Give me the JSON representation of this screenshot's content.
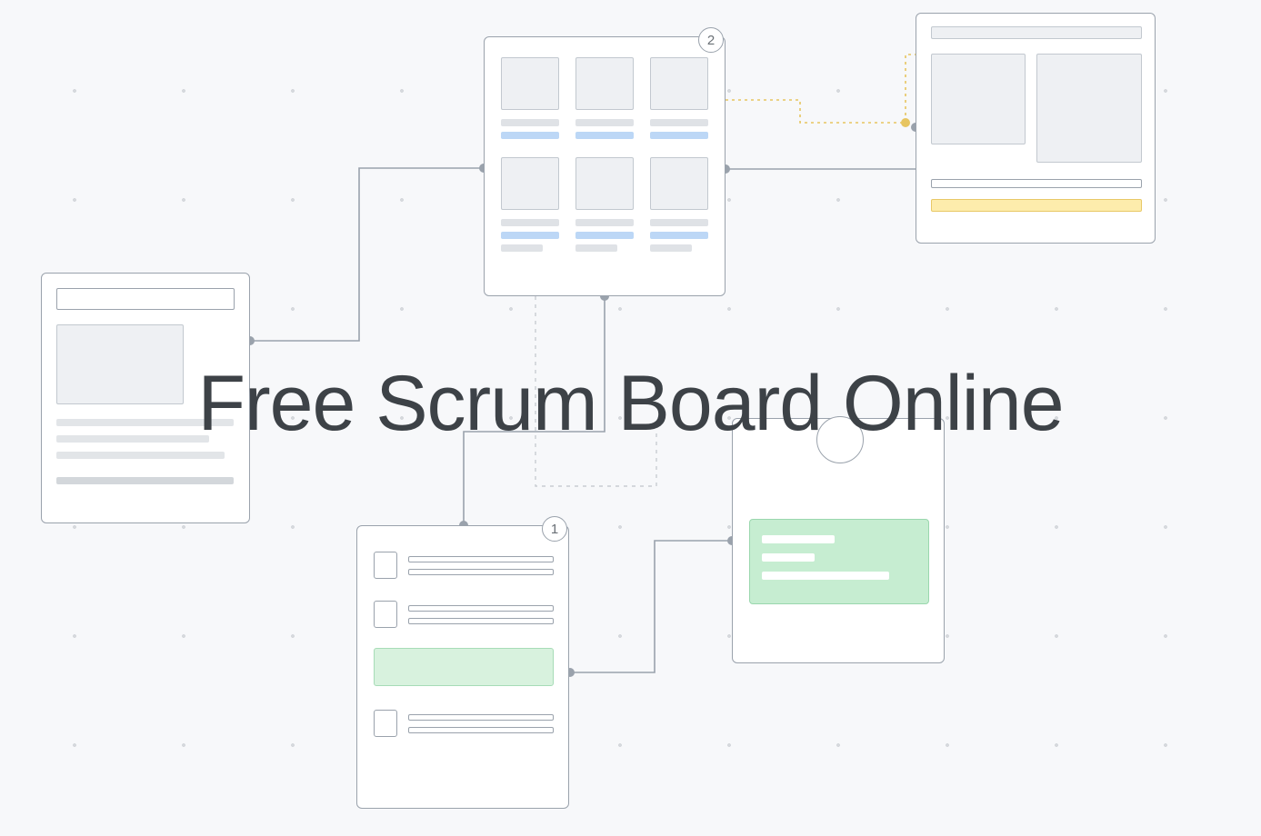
{
  "title": "Free Scrum Board Online",
  "badges": {
    "grid": "2",
    "list": "1"
  },
  "colors": {
    "bg": "#f7f8fa",
    "ink": "#3d4247",
    "stroke": "#9aa2ac",
    "blue": "#bcd7f6",
    "yellow": "#fdecac",
    "green": "#c6edd1"
  },
  "diagram": {
    "panels": [
      {
        "id": "left",
        "kind": "detail-card"
      },
      {
        "id": "grid",
        "kind": "thumbnail-grid",
        "rows": 2,
        "cols": 3
      },
      {
        "id": "right",
        "kind": "two-column-layout"
      },
      {
        "id": "list",
        "kind": "checklist",
        "items": 4
      },
      {
        "id": "card",
        "kind": "profile-card"
      }
    ],
    "connections": [
      {
        "from": "left",
        "to": "grid",
        "style": "solid"
      },
      {
        "from": "grid",
        "to": "right",
        "style": "solid"
      },
      {
        "from": "grid",
        "to": "right",
        "style": "dashed-yellow"
      },
      {
        "from": "grid",
        "to": "list",
        "style": "solid"
      },
      {
        "from": "grid",
        "to": "list",
        "style": "dashed-grey"
      },
      {
        "from": "list",
        "to": "card",
        "style": "solid"
      }
    ]
  }
}
